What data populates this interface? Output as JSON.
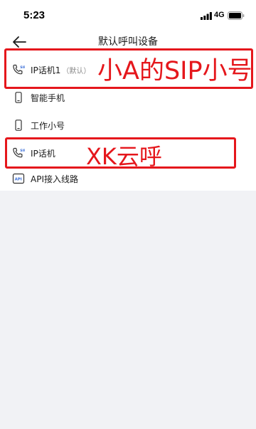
{
  "status_bar": {
    "time": "5:23",
    "network": "4G"
  },
  "header": {
    "title": "默认呼叫设备"
  },
  "device_list": {
    "items": [
      {
        "label": "IP话机1",
        "suffix": "（默认）",
        "icon": "sip-phone-icon"
      },
      {
        "label": "智能手机",
        "suffix": "",
        "icon": "smartphone-icon"
      },
      {
        "label": "工作小号",
        "suffix": "",
        "icon": "mobile-phone-icon"
      },
      {
        "label": "IP话机",
        "suffix": "",
        "icon": "sip-phone-icon"
      },
      {
        "label": "API接入线路",
        "suffix": "",
        "icon": "api-icon"
      }
    ]
  },
  "annotations": {
    "first": "小A的SIP小号",
    "second": "XK云呼",
    "color": "#e5171c"
  }
}
